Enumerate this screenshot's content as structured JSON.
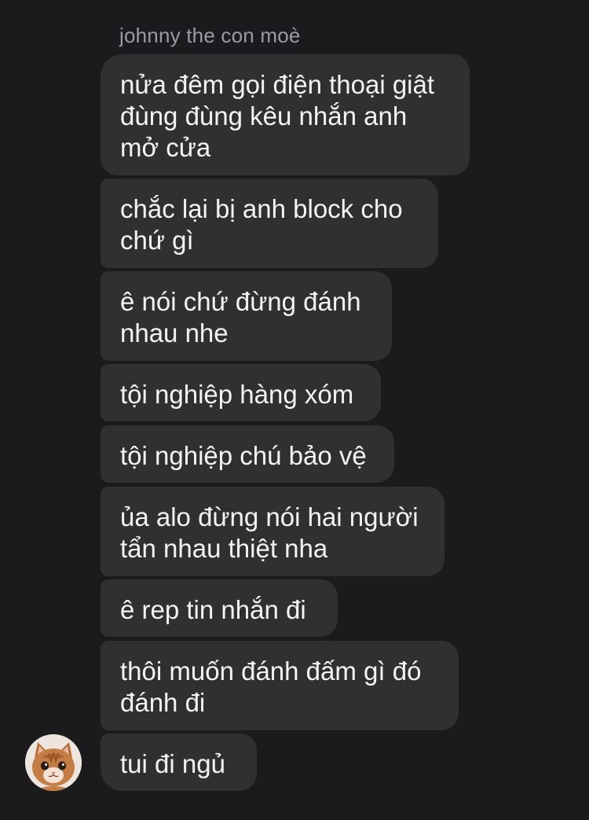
{
  "thread": {
    "sender_name": "johnny the con moè",
    "messages": [
      {
        "lines": [
          "nửa đêm gọi điện thoại giật",
          "đùng đùng kêu nhắn anh",
          "mở cửa"
        ]
      },
      {
        "lines": [
          "chắc lại bị anh block cho",
          "chứ gì"
        ]
      },
      {
        "lines": [
          "ê nói chứ đừng đánh",
          "nhau nhe"
        ]
      },
      {
        "lines": [
          "tội nghiệp hàng xóm"
        ]
      },
      {
        "lines": [
          "tội nghiệp chú bảo vệ"
        ]
      },
      {
        "lines": [
          "ủa alo đừng nói hai người",
          "tẩn nhau thiệt nha"
        ]
      },
      {
        "lines": [
          "ê rep tin nhắn đi"
        ]
      },
      {
        "lines": [
          "thôi muốn đánh đấm gì đó",
          "đánh đi"
        ]
      },
      {
        "lines": [
          "tui đi ngủ"
        ]
      }
    ],
    "avatar_icon": "cat-avatar-icon"
  },
  "colors": {
    "background": "#1b1b1d",
    "bubble": "#303033",
    "message_text": "#f3f3f5",
    "sender_name_text": "#9b9ba1"
  }
}
